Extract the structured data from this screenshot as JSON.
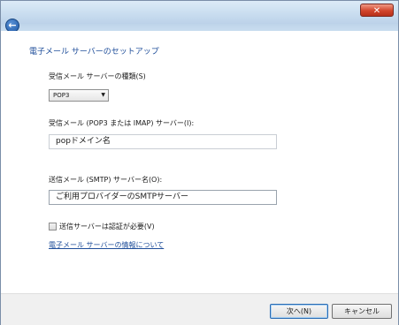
{
  "window": {
    "close_label": "✕"
  },
  "nav": {
    "back_label": "←"
  },
  "main": {
    "heading": "電子メール サーバーのセットアップ",
    "server_type_label": "受信メール サーバーの種類(S)",
    "server_type_value": "POP3",
    "incoming_label": "受信メール (POP3 または IMAP) サーバー(I):",
    "incoming_value": "popドメイン名",
    "outgoing_label": "送信メール (SMTP) サーバー名(O):",
    "outgoing_value": "ご利用プロバイダーのSMTPサーバー",
    "auth_label": "送信サーバーは認証が必要(V)",
    "info_link": "電子メール サーバーの情報について"
  },
  "footer": {
    "next_label": "次へ(N)",
    "cancel_label": "キャンセル"
  }
}
